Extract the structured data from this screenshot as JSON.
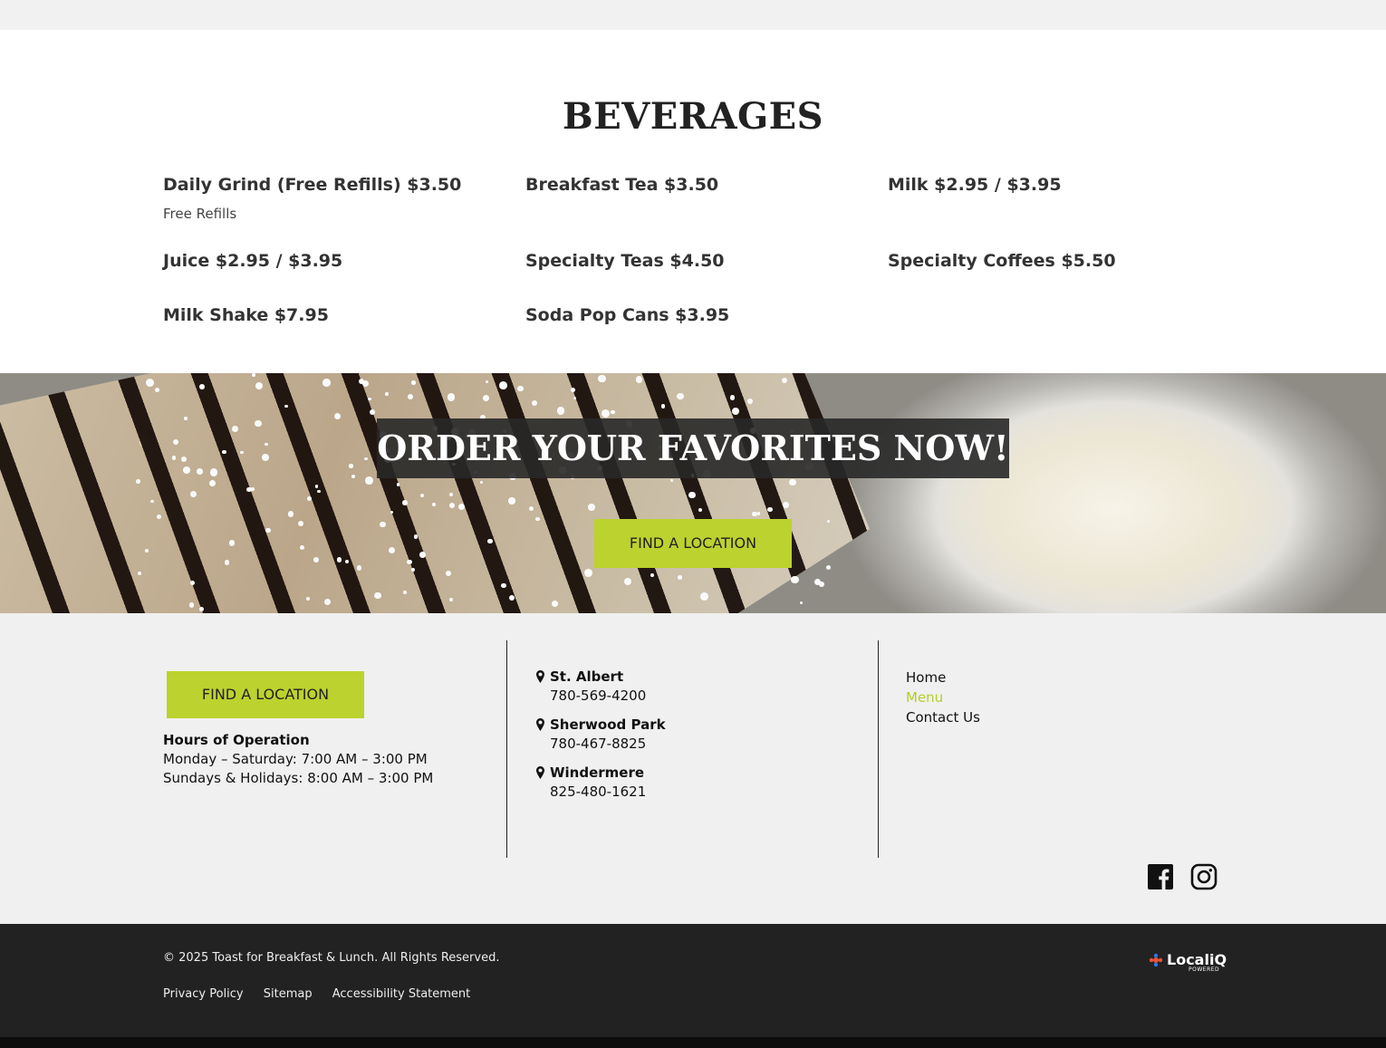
{
  "beverages": {
    "title": "BEVERAGES",
    "items": [
      {
        "name": "Daily Grind (Free Refills) $3.50",
        "description": "Free Refills"
      },
      {
        "name": "Breakfast Tea $3.50"
      },
      {
        "name": "Milk $2.95 / $3.95"
      },
      {
        "name": "Juice $2.95 / $3.95"
      },
      {
        "name": "Specialty Teas $4.50"
      },
      {
        "name": "Specialty Coffees $5.50"
      },
      {
        "name": "Milk Shake $7.95"
      },
      {
        "name": "Soda Pop Cans $3.95"
      }
    ]
  },
  "banner": {
    "title": "ORDER YOUR FAVORITES NOW!",
    "button_label": "FIND A LOCATION"
  },
  "footer": {
    "button_label": "FIND A LOCATION",
    "hours_title": "Hours of Operation",
    "hours_lines": [
      "Monday – Saturday: 7:00 AM – 3:00 PM",
      "Sundays & Holidays: 8:00 AM – 3:00 PM"
    ],
    "locations": [
      {
        "name": "St. Albert",
        "phone": "780-569-4200"
      },
      {
        "name": "Sherwood Park",
        "phone": "780-467-8825"
      },
      {
        "name": "Windermere",
        "phone": "825-480-1621"
      }
    ],
    "nav": [
      {
        "label": "Home",
        "active": false
      },
      {
        "label": "Menu",
        "active": true
      },
      {
        "label": "Contact Us",
        "active": false
      }
    ],
    "social_icons": [
      "facebook-icon",
      "instagram-icon"
    ],
    "accent_color": "#bcd22e"
  },
  "bottom_bar": {
    "copyright": "© 2025 Toast for Breakfast & Lunch. All Rights Reserved.",
    "links": [
      "Privacy Policy",
      "Sitemap",
      "Accessibility Statement"
    ],
    "badge_text": "LocaliQ",
    "badge_sub": "POWERED"
  }
}
